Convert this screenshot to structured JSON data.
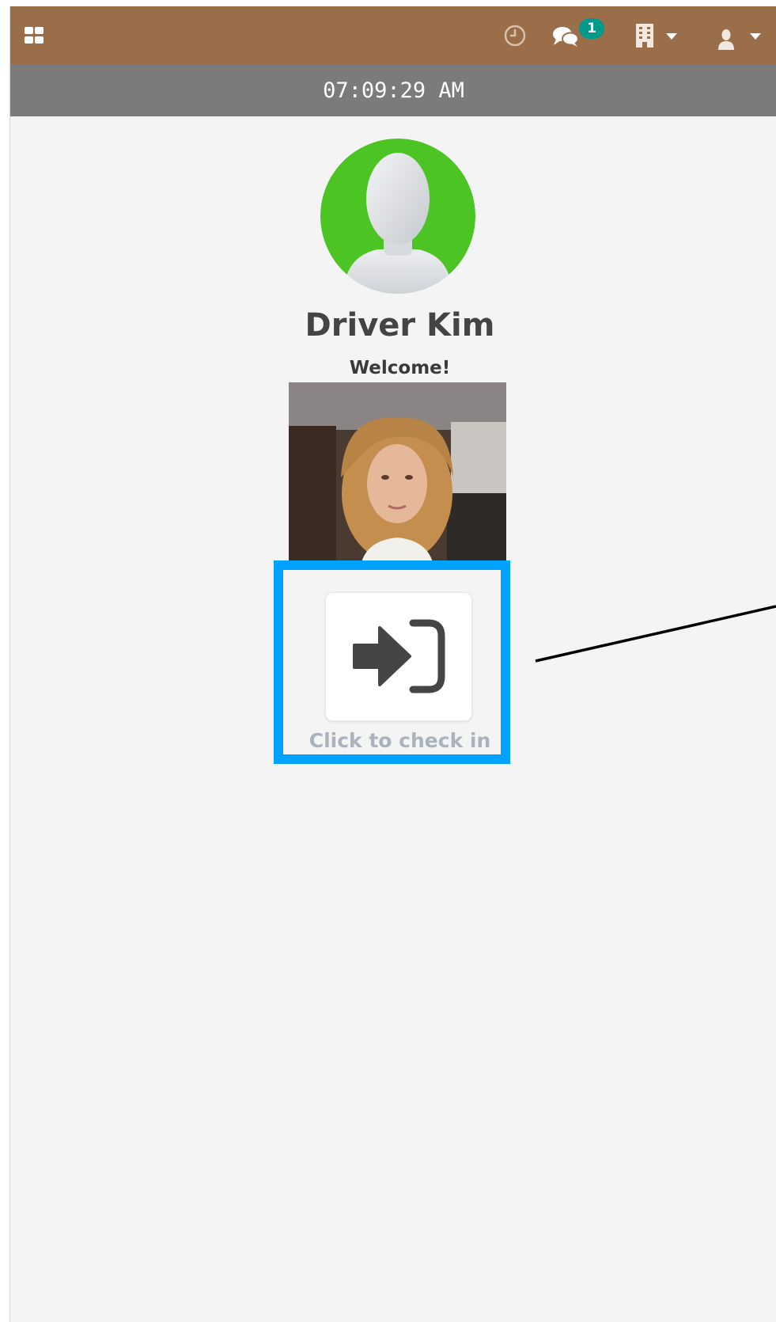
{
  "header": {
    "apps_icon": "apps-grid-icon",
    "history_icon": "clock-history-icon",
    "chat_icon": "chat-bubbles-icon",
    "chat_badge_count": "1",
    "company_icon": "building-icon",
    "user_icon": "user-icon",
    "dropdown_icon": "caret-down-icon"
  },
  "clock": {
    "time": "07:09:29 AM"
  },
  "employee": {
    "avatar_icon": "user-placeholder-icon",
    "name": "Driver Kim",
    "greeting": "Welcome!"
  },
  "checkin": {
    "icon": "sign-in-icon",
    "label": "Click to check in"
  },
  "colors": {
    "topbar": "#9b6e4a",
    "clockbar": "#7b7b7b",
    "avatar_ring": "#4cc424",
    "badge": "#00998a",
    "highlight": "#00a2ff"
  }
}
